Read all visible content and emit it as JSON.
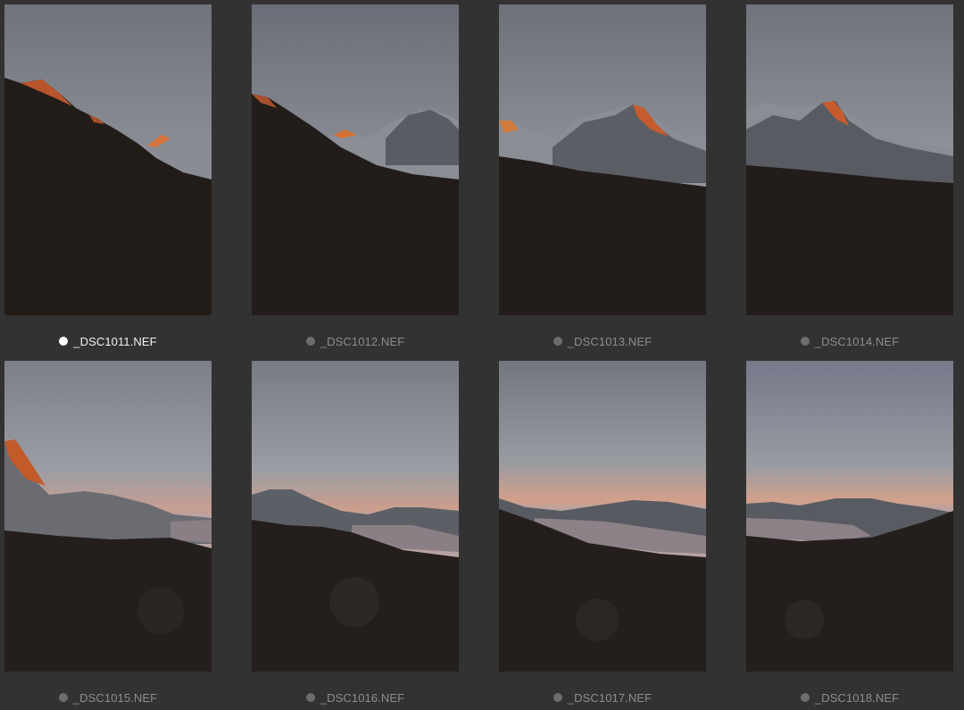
{
  "grid": {
    "items": [
      {
        "filename": "_DSC1011.NEF",
        "selected": true
      },
      {
        "filename": "_DSC1012.NEF",
        "selected": false
      },
      {
        "filename": "_DSC1013.NEF",
        "selected": false
      },
      {
        "filename": "_DSC1014.NEF",
        "selected": false
      },
      {
        "filename": "_DSC1015.NEF",
        "selected": false
      },
      {
        "filename": "_DSC1016.NEF",
        "selected": false
      },
      {
        "filename": "_DSC1017.NEF",
        "selected": false
      },
      {
        "filename": "_DSC1018.NEF",
        "selected": false
      }
    ]
  },
  "colors": {
    "background": "#333232",
    "selected_dot": "#ffffff",
    "unselected_dot": "#6d6d6d"
  }
}
